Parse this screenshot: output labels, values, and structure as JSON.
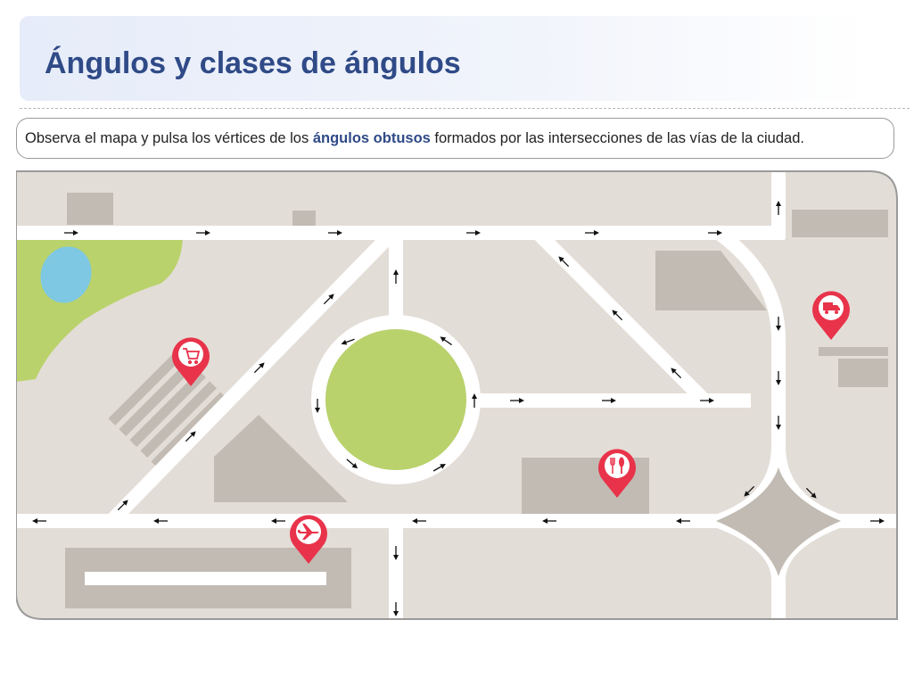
{
  "header": {
    "title": "Ángulos y clases de ángulos"
  },
  "instruction": {
    "before": "Observa el mapa y pulsa los vértices de los ",
    "highlight": "ángulos obtusos",
    "after": " formados por las intersecciones de las vías de la ciudad."
  },
  "map": {
    "colors": {
      "ground": "#e3ddd7",
      "road": "#ffffff",
      "building": "#c1bbb3",
      "park": "#b9d26c",
      "water": "#7ec8e3",
      "pin": "#e8334a",
      "border": "#9a9a9a",
      "arrow": "#111111"
    },
    "pins": [
      {
        "name": "shopping-cart-pin",
        "icon": "shopping-cart-icon"
      },
      {
        "name": "delivery-truck-pin",
        "icon": "delivery-truck-icon"
      },
      {
        "name": "restaurant-pin",
        "icon": "fork-knife-icon"
      },
      {
        "name": "airport-pin",
        "icon": "airplane-icon"
      }
    ]
  }
}
